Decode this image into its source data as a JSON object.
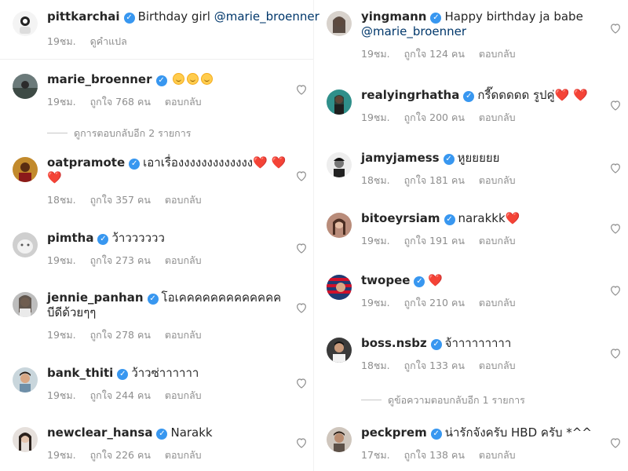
{
  "colors": {
    "verified": "#3897f0",
    "meta": "#8e8e8e",
    "mention": "#00376b",
    "heart": "#e0152b"
  },
  "left": {
    "caption": {
      "user": "pittkarchai",
      "text": "Birthday girl",
      "mention": "@marie_broenner",
      "time": "19ชม.",
      "translate": "ดูคำแปล"
    },
    "comments": [
      {
        "user": "marie_broenner",
        "text": "☺️ ☺️ ☺️",
        "time": "19ชม.",
        "likes": "ถูกใจ 768 คน",
        "reply": "ตอบกลับ"
      },
      {
        "user": "oatpramote",
        "text": "เอาเรื่องงงงงงงงงงงงง❤️ ❤️",
        "text2": "❤️",
        "time": "18ชม.",
        "likes": "ถูกใจ 357 คน",
        "reply": "ตอบกลับ"
      },
      {
        "user": "pimtha",
        "text": "ว้าวววววว",
        "time": "19ชม.",
        "likes": "ถูกใจ 273 คน",
        "reply": "ตอบกลับ"
      },
      {
        "user": "jennie_panhan",
        "text": "โอเคคคคคคคคคคคคค",
        "text2": "บีดีด้วยๆๆ",
        "time": "19ชม.",
        "likes": "ถูกใจ 278 คน",
        "reply": "ตอบกลับ"
      },
      {
        "user": "bank_thiti",
        "text": "ว้าวซ่าาาาาา",
        "time": "19ชม.",
        "likes": "ถูกใจ 244 คน",
        "reply": "ตอบกลับ"
      },
      {
        "user": "newclear_hansa",
        "text": "Narakk",
        "time": "19ชม.",
        "likes": "ถูกใจ 226 คน",
        "reply": "ตอบกลับ"
      }
    ],
    "view_replies": "ดูการตอบกลับอีก 2 รายการ"
  },
  "right": {
    "comments": [
      {
        "user": "yingmann",
        "text": "Happy birthday ja babe",
        "mention": "@marie_broenner",
        "time": "19ชม.",
        "likes": "ถูกใจ 124 คน",
        "reply": "ตอบกลับ"
      },
      {
        "user": "realyingrhatha",
        "text": "กรี๊ดดดดด รูปคู่❤️ ❤️",
        "time": "19ชม.",
        "likes": "ถูกใจ 200 คน",
        "reply": "ตอบกลับ"
      },
      {
        "user": "jamyjamess",
        "text": "หูยยยยย",
        "time": "18ชม.",
        "likes": "ถูกใจ 181 คน",
        "reply": "ตอบกลับ"
      },
      {
        "user": "bitoeyrsiam",
        "text": "narakkk❤️",
        "time": "19ชม.",
        "likes": "ถูกใจ 191 คน",
        "reply": "ตอบกลับ"
      },
      {
        "user": "twopee",
        "text": "❤️",
        "time": "19ชม.",
        "likes": "ถูกใจ 210 คน",
        "reply": "ตอบกลับ"
      },
      {
        "user": "boss.nsbz",
        "text": "จ้าาาาาาาาา",
        "time": "18ชม.",
        "likes": "ถูกใจ 133 คน",
        "reply": "ตอบกลับ"
      },
      {
        "user": "peckprem",
        "text": "น่ารักจังครับ HBD ครับ *^^",
        "time": "17ชม.",
        "likes": "ถูกใจ 138 คน",
        "reply": "ตอบกลับ"
      }
    ],
    "view_replies": "ดูข้อความตอบกลับอีก 1 รายการ"
  }
}
